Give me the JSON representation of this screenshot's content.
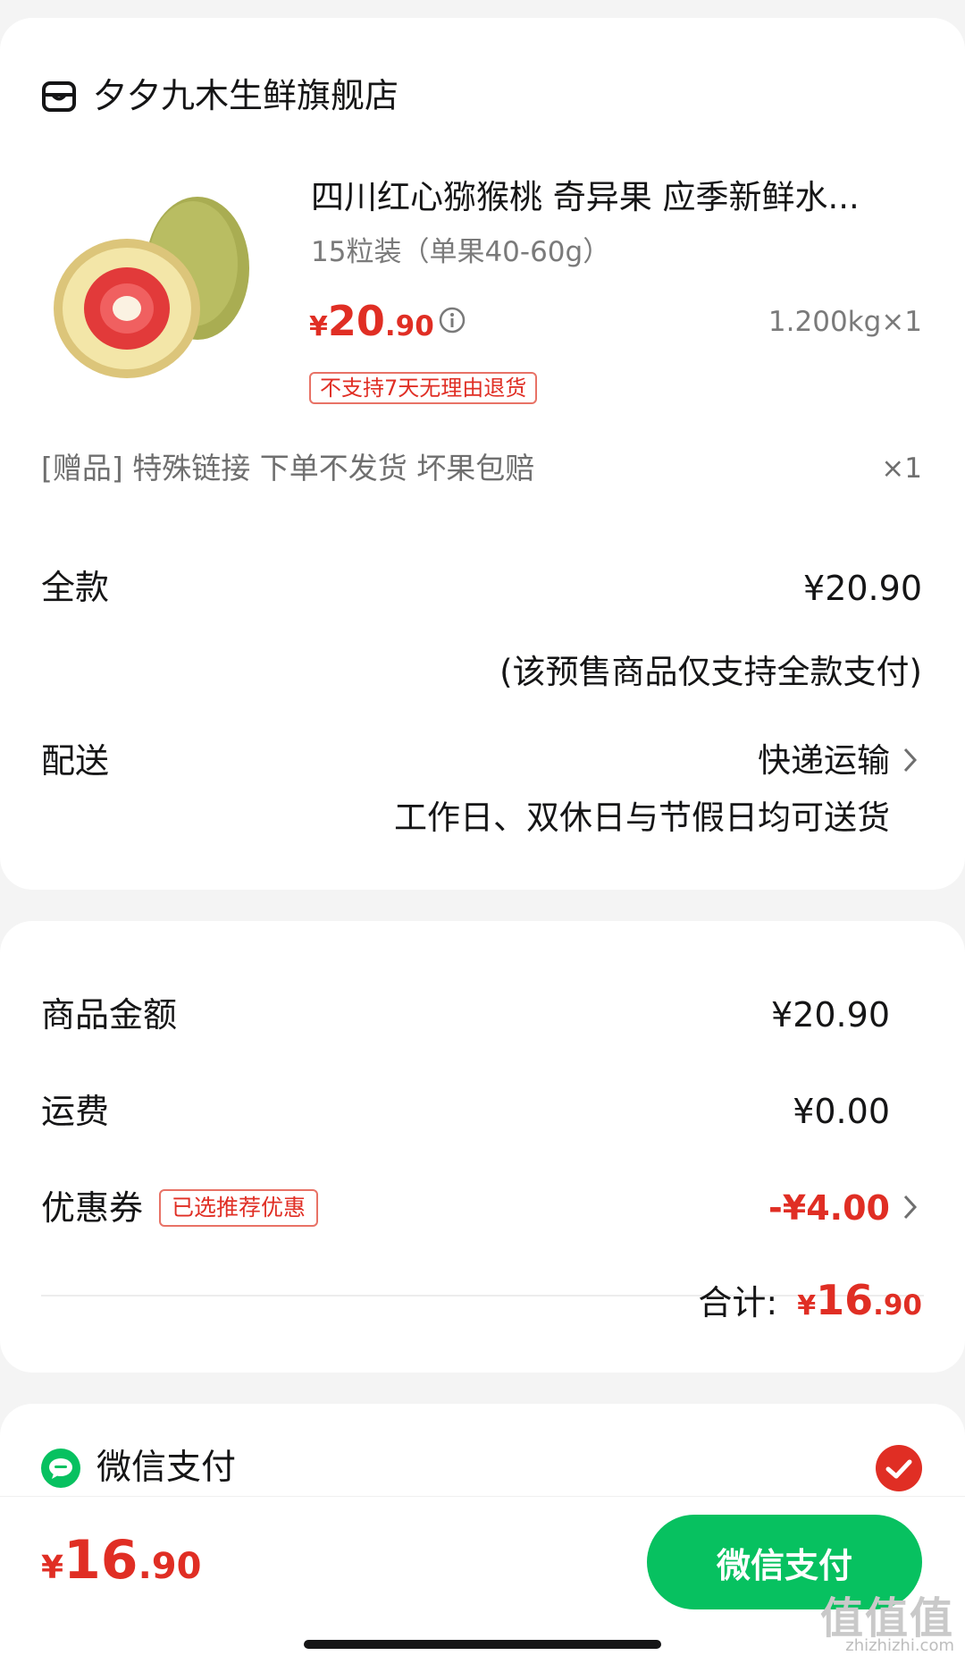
{
  "store": {
    "name": "夕夕九木生鲜旗舰店",
    "icon": "store-icon"
  },
  "product": {
    "title": "四川红心猕猴桃 奇异果 应季新鲜水...",
    "spec": "15粒装（单果40-60g）",
    "price_yen": "¥",
    "price_int": "20",
    "price_dec": ".90",
    "weight_qty": "1.200kg×1",
    "no_return_tag": "不支持7天无理由退货"
  },
  "gift": {
    "text": "[赠品] 特殊链接 下单不发货 坏果包赔",
    "qty": "×1"
  },
  "payment_option": {
    "label": "全款",
    "value": "¥20.90",
    "note": "(该预售商品仅支持全款支付)"
  },
  "delivery": {
    "label": "配送",
    "method": "快递运输",
    "note": "工作日、双休日与节假日均可送货"
  },
  "summary": {
    "goods_label": "商品金额",
    "goods_value": "¥20.90",
    "shipping_label": "运费",
    "shipping_value": "¥0.00",
    "coupon_label": "优惠券",
    "coupon_tag": "已选推荐优惠",
    "coupon_value": "-¥4.00",
    "total_label": "合计:",
    "total_yen": "¥",
    "total_int": "16",
    "total_dec": ".90"
  },
  "pay_method": {
    "label": "微信支付",
    "selected": true
  },
  "bottom_bar": {
    "yen": "¥",
    "int": "16",
    "dec": ".90",
    "button_label": "微信支付"
  },
  "watermark": {
    "text": "值值值",
    "sub": "zhizhizhi.com"
  },
  "colors": {
    "accent_red": "#e02e24",
    "wechat_green": "#07c160",
    "background": "#f4f4f4"
  }
}
